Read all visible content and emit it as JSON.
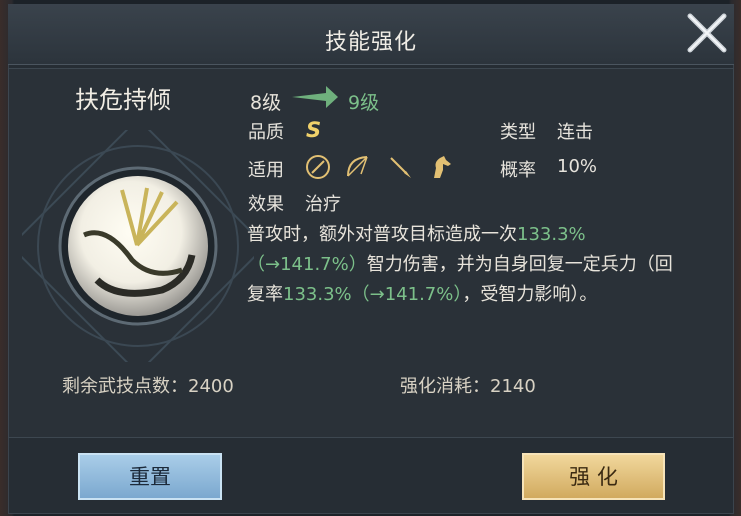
{
  "dialog": {
    "title": "技能强化"
  },
  "skill": {
    "name": "扶危持倾",
    "level_from": "8级",
    "level_to": "9级",
    "grade_label": "品质",
    "grade_value": "S",
    "type_label": "类型",
    "type_value": "连击",
    "apply_label": "适用",
    "apply_icons": [
      "shield-icon",
      "bow-icon",
      "spear-icon",
      "horse-icon"
    ],
    "chance_label": "概率",
    "chance_value": "10%",
    "effect_label": "效果",
    "effect_value": "治疗",
    "description": {
      "p1": "普攻时，额外对普攻目标造成一次",
      "v1": "133.3%",
      "v2": "（→141.7%）",
      "p2": "智力伤害，并为自身回复一定兵力（回复率",
      "v3": "133.3%（→141.7%）",
      "p3": "，受智力影响）。"
    }
  },
  "footer": {
    "remaining": "剩余武技点数：2400",
    "cost": "强化消耗：2140"
  },
  "buttons": {
    "reset": "重置",
    "upgrade": "强 化"
  },
  "colors": {
    "highlight": "#7cc08a",
    "grade": "#f0d16a",
    "reset_button": "#93bde0",
    "upgrade_button": "#e2c079"
  }
}
